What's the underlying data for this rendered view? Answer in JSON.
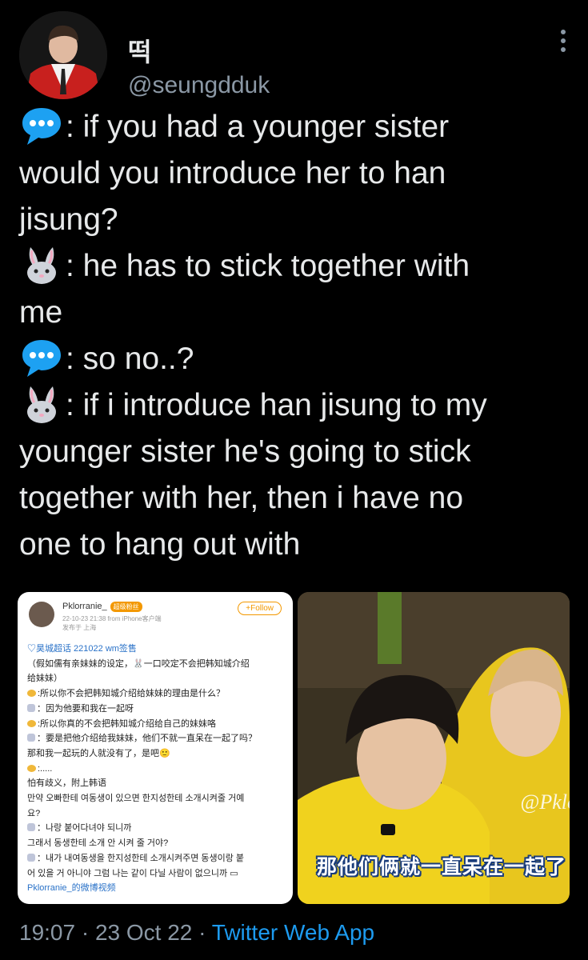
{
  "author": {
    "name": "떡",
    "handle": "@seungdduk"
  },
  "tweet_lines": [
    {
      "icon": "speech-bubble-icon",
      "text": ": if you had a younger sister"
    },
    {
      "icon": "",
      "text": "would you introduce her to han"
    },
    {
      "icon": "",
      "text": "jisung?"
    },
    {
      "icon": "rabbit-icon",
      "text": ": he has to stick together with"
    },
    {
      "icon": "",
      "text": "me"
    },
    {
      "icon": "speech-bubble-icon",
      "text": ": so no..?"
    },
    {
      "icon": "rabbit-icon",
      "text": ": if i introduce han jisung to my"
    },
    {
      "icon": "",
      "text": "younger sister he's going to stick"
    },
    {
      "icon": "",
      "text": "together with her, then i have no"
    },
    {
      "icon": "",
      "text": "one to hang out with"
    }
  ],
  "weibo": {
    "name": "Pklorranie_",
    "tag": "超级粉丝",
    "follow": "+Follow",
    "time": "22-10-23 21:38 from iPhone客户端",
    "location": "发布于 上海",
    "lines": [
      {
        "mark": "",
        "text": "♡昊城超话 221022 wm签售",
        "link": true
      },
      {
        "mark": "",
        "text": "（假如儒有亲妹妹的设定，🐰一口咬定不会把韩知城介绍",
        "link": false
      },
      {
        "mark": "",
        "text": "给妹妹）",
        "link": false
      },
      {
        "mark": "emoji",
        "text": ":所以你不会把韩知城介绍给妹妹的理由是什么？",
        "link": false
      },
      {
        "mark": "rabbit",
        "text": "：因为他要和我在一起呀",
        "link": false
      },
      {
        "mark": "emoji",
        "text": ":所以你真的不会把韩知城介绍给自己的妹妹咯",
        "link": false
      },
      {
        "mark": "rabbit",
        "text": "：要是把他介绍给我妹妹，他们不就一直呆在一起了吗？",
        "link": false
      },
      {
        "mark": "",
        "text": "那和我一起玩的人就没有了，是吧🙂",
        "link": false
      },
      {
        "mark": "emoji",
        "text": ":.....",
        "link": false
      },
      {
        "mark": "",
        "text": "怕有歧义，附上韩语",
        "link": false
      },
      {
        "mark": "",
        "text": "만약 오빠한테 여동생이 있으면 한지성한테 소개시켜줄 거예",
        "link": false
      },
      {
        "mark": "",
        "text": "요?",
        "link": false
      },
      {
        "mark": "rabbit",
        "text": "：나랑 붙어다녀야 되니까",
        "link": false
      },
      {
        "mark": "",
        "text": "그래서 동생한테 소개 안 시켜 줄 거야?",
        "link": false
      },
      {
        "mark": "rabbit",
        "text": "：내가 내여동생을 한지성한테 소개시켜주면 동생이랑 붙",
        "link": false
      },
      {
        "mark": "",
        "text": "어 있을 거 아니야 그럼 나는 같이 다닐 사람이 없으니까 ▭",
        "link": false
      },
      {
        "mark": "",
        "text": "Pklorranie_的微博视频",
        "link": true
      }
    ]
  },
  "video": {
    "watermark": "@Pklo",
    "subtitle": "那他们俩就一直呆在一起了"
  },
  "footer": {
    "time": "19:07",
    "sep1": " · ",
    "date": "23 Oct 22",
    "sep2": " · ",
    "source": "Twitter Web App"
  }
}
